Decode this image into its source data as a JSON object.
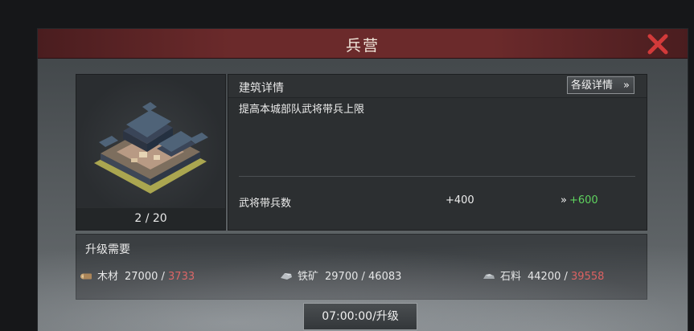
{
  "dialog": {
    "title": "兵营",
    "level": {
      "current": "2",
      "separator": "/",
      "max": "20"
    },
    "details_title": "建筑详情",
    "details_button_label": "各级详情",
    "details_button_chevron": "»",
    "description": "提高本城部队武将带兵上限",
    "stat": {
      "label": "武将带兵数",
      "current_value": "+400",
      "arrow": "»",
      "next_value": "+600"
    },
    "upgrade": {
      "title": "升级需要",
      "resources": [
        {
          "icon": "wood-icon",
          "name": "木材",
          "required": "27000",
          "separator": " / ",
          "have": "3733",
          "sufficient": false
        },
        {
          "icon": "iron-ore-icon",
          "name": "铁矿",
          "required": "29700",
          "separator": " / ",
          "have": "46083",
          "sufficient": true
        },
        {
          "icon": "stone-icon",
          "name": "石料",
          "required": "44200",
          "separator": " / ",
          "have": "39558",
          "sufficient": false
        }
      ]
    },
    "action_button_label": "07:00:00/升级"
  },
  "colors": {
    "title_bar": "#6b2a2b",
    "close_icon": "#d23a3a",
    "insufficient": "#e05555",
    "increase": "#5fd35f"
  }
}
